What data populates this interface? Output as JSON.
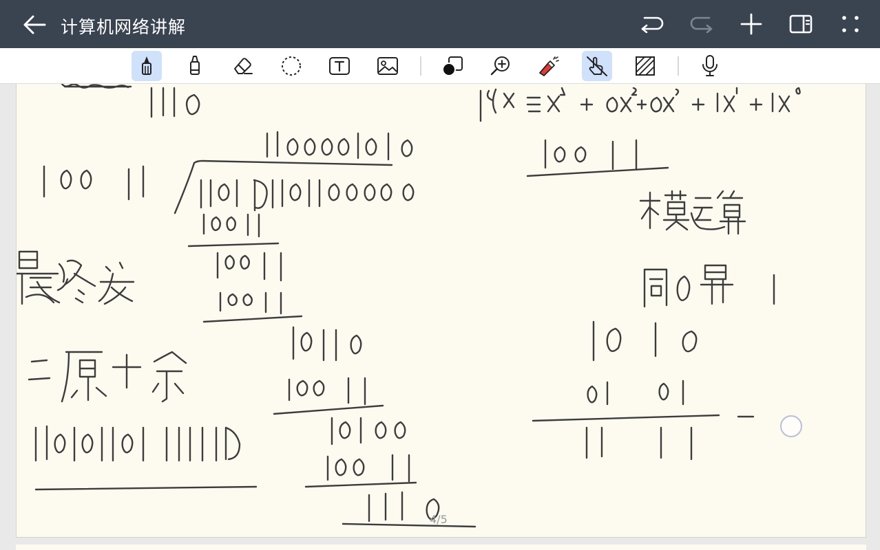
{
  "app": {
    "title": "计算机网络讲解"
  },
  "titlebar_actions": [
    {
      "name": "undo",
      "icon": "undo-icon",
      "enabled": true
    },
    {
      "name": "redo",
      "icon": "redo-icon",
      "enabled": false
    },
    {
      "name": "add-page",
      "icon": "plus-icon",
      "enabled": true
    },
    {
      "name": "sidebar-toggle",
      "icon": "panel-icon",
      "enabled": true
    },
    {
      "name": "more",
      "icon": "more-dots-icon",
      "enabled": true
    }
  ],
  "tools": [
    {
      "name": "pen",
      "icon": "pen-icon",
      "active": true
    },
    {
      "name": "highlighter",
      "icon": "highlighter-icon",
      "active": false
    },
    {
      "name": "eraser",
      "icon": "eraser-icon",
      "active": false
    },
    {
      "name": "lasso",
      "icon": "lasso-icon",
      "active": false
    },
    {
      "name": "text",
      "icon": "text-box-icon",
      "active": false
    },
    {
      "name": "image",
      "icon": "image-icon",
      "active": false
    },
    {
      "name": "color",
      "icon": "color-swatch-icon",
      "active": false,
      "value": "#111111"
    },
    {
      "name": "zoom",
      "icon": "zoom-in-icon",
      "active": false
    },
    {
      "name": "laser",
      "icon": "laser-pointer-icon",
      "active": false
    },
    {
      "name": "touch-write",
      "icon": "hand-write-icon",
      "active": true
    },
    {
      "name": "background",
      "icon": "hatch-background-icon",
      "active": false
    },
    {
      "name": "voice",
      "icon": "microphone-icon",
      "active": false
    }
  ],
  "page": {
    "indicator": "4/5"
  },
  "colors": {
    "titlebar": "#3a4350",
    "accent": "#cfe1fb",
    "paper": "#fdfaf0",
    "ink": "#3c3c3c"
  }
}
